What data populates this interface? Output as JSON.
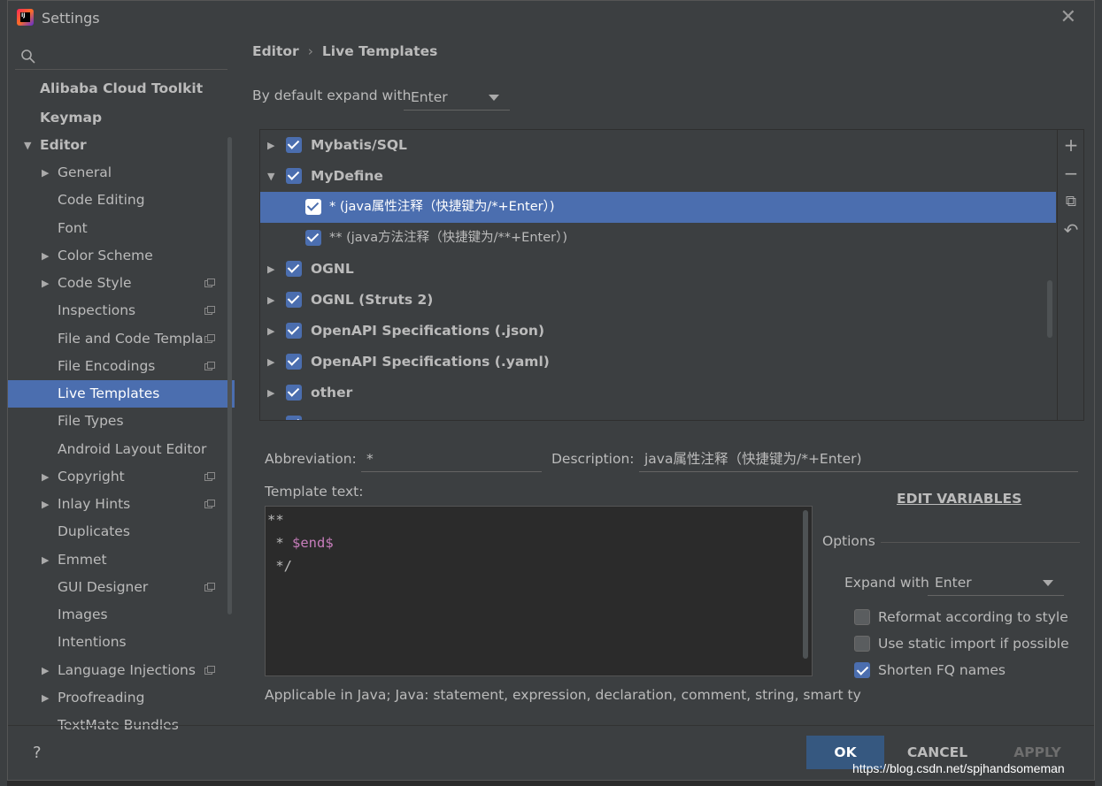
{
  "window": {
    "title": "Settings",
    "close_glyph": "✕"
  },
  "sidebar": {
    "search_placeholder": "",
    "items": [
      {
        "label": "Alibaba Cloud Toolkit"
      },
      {
        "label": "Keymap"
      },
      {
        "label": "Editor"
      },
      {
        "label": "General"
      },
      {
        "label": "Code Editing"
      },
      {
        "label": "Font"
      },
      {
        "label": "Color Scheme"
      },
      {
        "label": "Code Style"
      },
      {
        "label": "Inspections"
      },
      {
        "label": "File and Code Templates"
      },
      {
        "label": "File Encodings"
      },
      {
        "label": "Live Templates"
      },
      {
        "label": "File Types"
      },
      {
        "label": "Android Layout Editor"
      },
      {
        "label": "Copyright"
      },
      {
        "label": "Inlay Hints"
      },
      {
        "label": "Duplicates"
      },
      {
        "label": "Emmet"
      },
      {
        "label": "GUI Designer"
      },
      {
        "label": "Images"
      },
      {
        "label": "Intentions"
      },
      {
        "label": "Language Injections"
      },
      {
        "label": "Proofreading"
      },
      {
        "label": "TextMate Bundles"
      }
    ],
    "selected": "Live Templates"
  },
  "breadcrumb": {
    "parent": "Editor",
    "sep": "›",
    "current": "Live Templates"
  },
  "expand": {
    "label": "By default expand with",
    "value": "Enter"
  },
  "templates": {
    "rows": [
      {
        "label": "Mybatis/SQL"
      },
      {
        "label": "MyDefine"
      },
      {
        "label": "* (java属性注释（快捷键为/*+Enter）)"
      },
      {
        "label": "** (java方法注释（快捷键为/**+Enter）)"
      },
      {
        "label": "OGNL"
      },
      {
        "label": "OGNL (Struts 2)"
      },
      {
        "label": "OpenAPI Specifications (.json)"
      },
      {
        "label": "OpenAPI Specifications (.yaml)"
      },
      {
        "label": "other"
      }
    ],
    "toolbar": {
      "add": "+",
      "remove": "−",
      "copy": "⧉",
      "restore": "↶"
    }
  },
  "details": {
    "abbreviation_label": "Abbreviation:",
    "abbreviation_value": "*",
    "description_label": "Description:",
    "description_value": "java属性注释（快捷键为/*+Enter)",
    "template_text_label": "Template text:",
    "template_lines": [
      "**",
      " * ",
      "$end$",
      " */"
    ],
    "applicable": "Applicable in Java; Java: statement, expression, declaration, comment, string, smart ty"
  },
  "edit_variables": "EDIT VARIABLES",
  "options": {
    "title": "Options",
    "expand_with_label": "Expand with",
    "expand_with_value": "Enter",
    "reformat": {
      "label": "Reformat according to style",
      "checked": false
    },
    "static_import": {
      "label": "Use static import if possible",
      "checked": false
    },
    "shorten_fq": {
      "label": "Shorten FQ names",
      "checked": true
    }
  },
  "footer": {
    "help": "?",
    "ok": "OK",
    "cancel": "CANCEL",
    "apply": "APPLY"
  },
  "watermark": "https://blog.csdn.net/spjhandsomeman",
  "colors": {
    "selection": "#4b6eaf",
    "panel": "#3c3f41",
    "editor_bg": "#2b2b2b",
    "variable": "#c77dbb",
    "ok_button": "#365880"
  }
}
